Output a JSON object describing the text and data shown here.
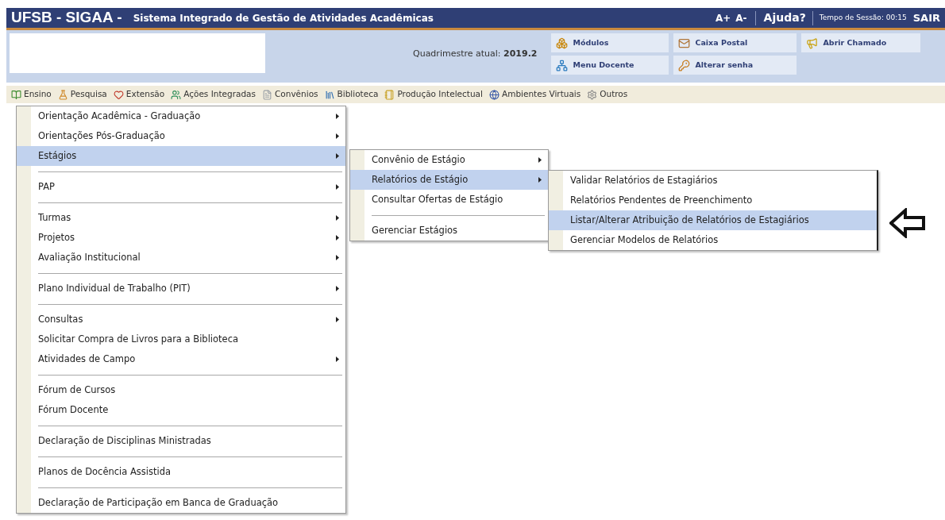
{
  "title_bar": {
    "system": "UFSB - SIGAA -",
    "subtitle": "Sistema Integrado de Gestão de Atividades Acadêmicas",
    "font_up": "A+",
    "font_down": "A-",
    "help": "Ajuda?",
    "session": "Tempo de Sessão: 00:15",
    "logout": "SAIR"
  },
  "header": {
    "period": "Quadrimestre atual: **2019.2**",
    "shortcuts": [
      {
        "label": "Módulos"
      },
      {
        "label": "Caixa Postal"
      },
      {
        "label": "Abrir Chamado"
      },
      {
        "label": "Menu Docente"
      },
      {
        "label": "Alterar senha"
      }
    ]
  },
  "menu_bar": [
    {
      "label": "Ensino"
    },
    {
      "label": "Pesquisa"
    },
    {
      "label": "Extensão"
    },
    {
      "label": "Ações Integradas"
    },
    {
      "label": "Convênios"
    },
    {
      "label": "Biblioteca"
    },
    {
      "label": "Produção Intelectual"
    },
    {
      "label": "Ambientes Virtuais"
    },
    {
      "label": "Outros"
    }
  ],
  "dropdown": [
    {
      "label": "Orientação Acadêmica - Graduação",
      "submenu": true,
      "selected": false,
      "separator_after": false
    },
    {
      "label": "Orientações Pós-Graduação",
      "submenu": true,
      "selected": false,
      "separator_after": false
    },
    {
      "label": "Estágios",
      "submenu": true,
      "selected": true,
      "separator_after": true
    },
    {
      "label": "PAP",
      "submenu": true,
      "selected": false,
      "separator_after": true
    },
    {
      "label": "Turmas",
      "submenu": true,
      "selected": false,
      "separator_after": false
    },
    {
      "label": "Projetos",
      "submenu": true,
      "selected": false,
      "separator_after": false
    },
    {
      "label": "Avaliação Institucional",
      "submenu": true,
      "selected": false,
      "separator_after": true
    },
    {
      "label": "Plano Individual de Trabalho (PIT)",
      "submenu": true,
      "selected": false,
      "separator_after": true
    },
    {
      "label": "Consultas",
      "submenu": true,
      "selected": false,
      "separator_after": false
    },
    {
      "label": "Solicitar Compra de Livros para a Biblioteca",
      "submenu": false,
      "selected": false,
      "separator_after": false
    },
    {
      "label": "Atividades de Campo",
      "submenu": true,
      "selected": false,
      "separator_after": true
    },
    {
      "label": "Fórum de Cursos",
      "submenu": false,
      "selected": false,
      "separator_after": false
    },
    {
      "label": "Fórum Docente",
      "submenu": false,
      "selected": false,
      "separator_after": true
    },
    {
      "label": "Declaração de Disciplinas Ministradas",
      "submenu": false,
      "selected": false,
      "separator_after": true
    },
    {
      "label": "Planos de Docência Assistida",
      "submenu": false,
      "selected": false,
      "separator_after": true
    },
    {
      "label": "Declaração de Participação em Banca de Graduação",
      "submenu": false,
      "selected": false,
      "separator_after": false
    }
  ],
  "submenu": [
    {
      "label": "Convênio de Estágio",
      "submenu": true,
      "selected": false,
      "separator_after": false
    },
    {
      "label": "Relatórios de Estágio",
      "submenu": true,
      "selected": true,
      "separator_after": false
    },
    {
      "label": "Consultar Ofertas de Estágio",
      "submenu": false,
      "selected": false,
      "separator_after": true
    },
    {
      "label": "Gerenciar Estágios",
      "submenu": false,
      "selected": false,
      "separator_after": false
    }
  ],
  "sub_submenu": [
    {
      "label": "Validar Relatórios de Estagiários",
      "submenu": false,
      "selected": false,
      "separator_after": false
    },
    {
      "label": "Relatórios Pendentes de Preenchimento",
      "submenu": false,
      "selected": false,
      "separator_after": false
    },
    {
      "label": "Listar/Alterar Atribuição de Relatórios de Estagiários",
      "submenu": false,
      "selected": true,
      "separator_after": false
    },
    {
      "label": "Gerenciar Modelos de Relatórios",
      "submenu": false,
      "selected": false,
      "separator_after": false
    }
  ]
}
